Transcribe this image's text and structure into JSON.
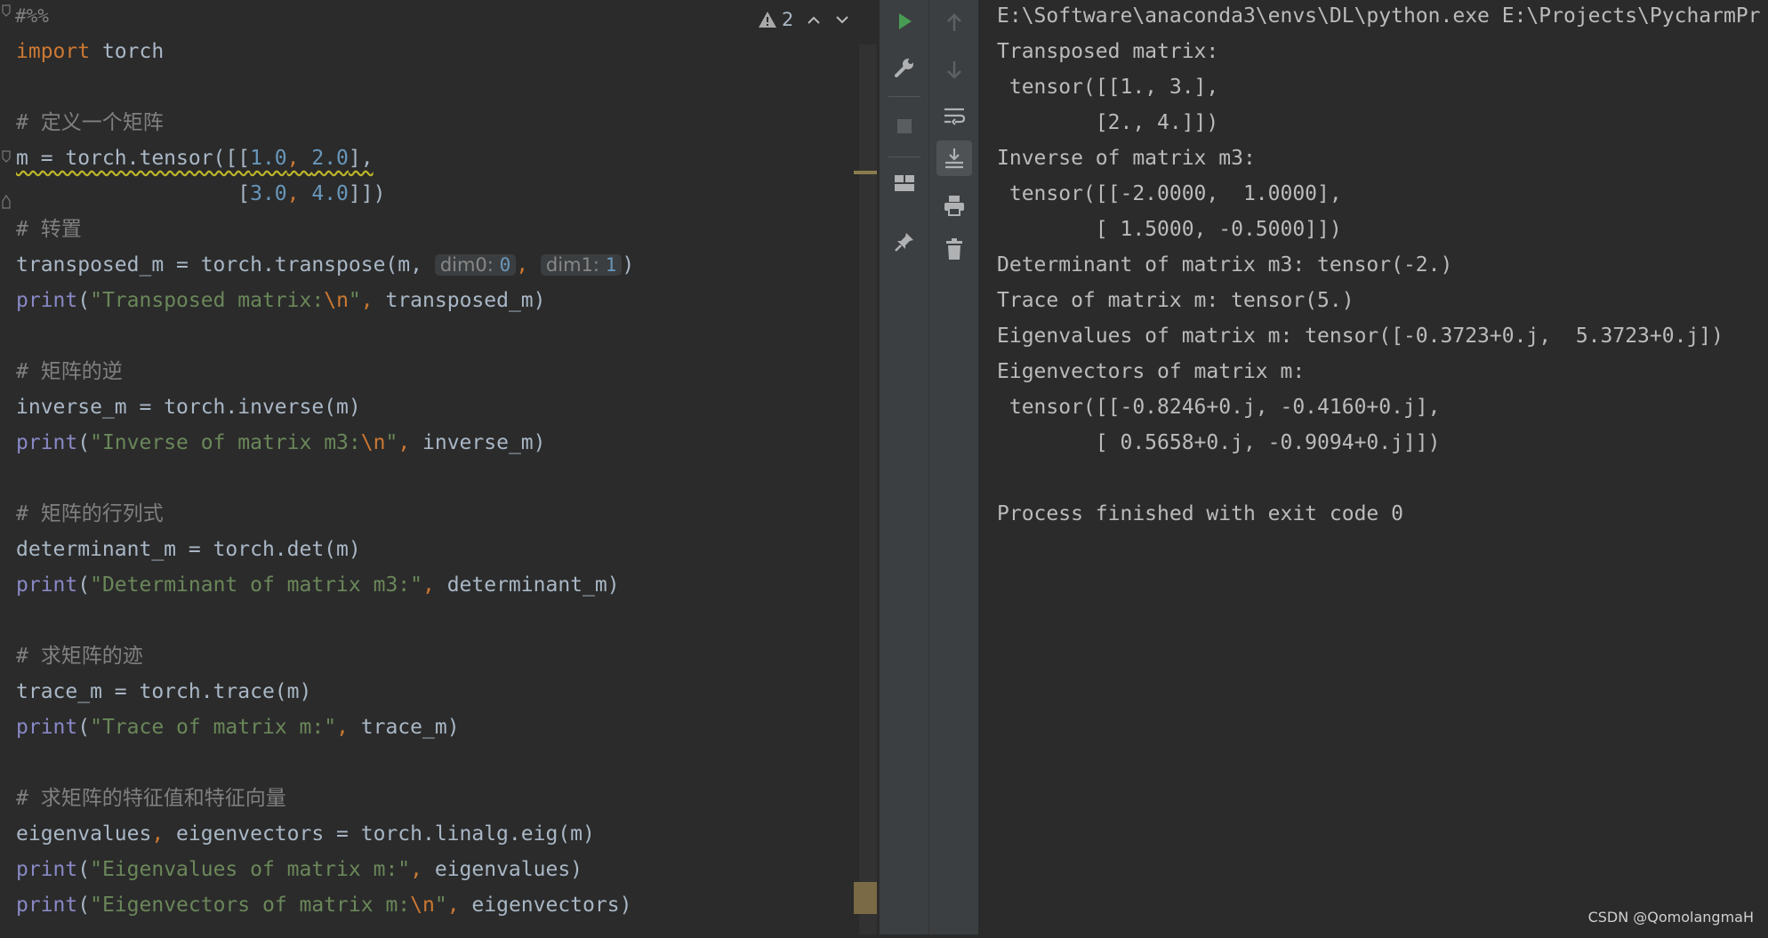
{
  "editor": {
    "cell_marker": "#%%",
    "l_import_kw": "import",
    "l_import_mod": " torch",
    "c_define": "# 定义一个矩阵",
    "l_m_pre": "m = torch.tensor([[",
    "n_1": "1.0",
    "n_2": "2.0",
    "l_m_post": "],",
    "l_m2_pre": "                  [",
    "n_3": "3.0",
    "n_4": "4.0",
    "l_m2_post": "]])",
    "comma_sep": ", ",
    "c_transpose": "# 转置",
    "l_tr_pre": "transposed_m = torch.transpose(m, ",
    "hint_dim0": "dim0:",
    "hint_dim0_val": "0",
    "hint_dim1": "dim1:",
    "hint_dim1_val": "1",
    "paren_close": ")",
    "print_kw": "print",
    "s_transposed": "\"Transposed matrix:",
    "esc_n": "\\n",
    "quote": "\"",
    "arg_transposed": " transposed_m)",
    "c_inverse": "# 矩阵的逆",
    "l_inv": "inverse_m = torch.inverse(m)",
    "s_inverse": "\"Inverse of matrix m3:",
    "arg_inverse": " inverse_m)",
    "c_det": "# 矩阵的行列式",
    "l_det": "determinant_m = torch.det(m)",
    "s_det": "\"Determinant of matrix m3:\"",
    "arg_det": " determinant_m)",
    "c_trace": "# 求矩阵的迹",
    "l_trace": "trace_m = torch.trace(m)",
    "s_trace": "\"Trace of matrix m:\"",
    "arg_trace": " trace_m)",
    "c_eig": "# 求矩阵的特征值和特征向量",
    "l_eig_a": "eigenvalues",
    "l_eig_b": " eigenvectors = torch.linalg.eig(m)",
    "s_eigval": "\"Eigenvalues of matrix m:\"",
    "arg_eigval": " eigenvalues)",
    "s_eigvec": "\"Eigenvectors of matrix m:",
    "arg_eigvec": " eigenvectors)",
    "open_paren": "(",
    "comma": ","
  },
  "inspection": {
    "warning_count": "2",
    "icon": "warning-icon",
    "warning_color": "#a9a9a9"
  },
  "console": {
    "lines": [
      "E:\\Software\\anaconda3\\envs\\DL\\python.exe E:\\Projects\\PycharmPr",
      "Transposed matrix:",
      " tensor([[1., 3.],",
      "        [2., 4.]])",
      "Inverse of matrix m3:",
      " tensor([[-2.0000,  1.0000],",
      "        [ 1.5000, -0.5000]])",
      "Determinant of matrix m3: tensor(-2.)",
      "Trace of matrix m: tensor(5.)",
      "Eigenvalues of matrix m: tensor([-0.3723+0.j,  5.3723+0.j])",
      "Eigenvectors of matrix m:",
      " tensor([[-0.8246+0.j, -0.4160+0.j],",
      "        [ 0.5658+0.j, -0.9094+0.j]])",
      "",
      "Process finished with exit code 0"
    ]
  },
  "toolbar": {
    "icons": [
      "run-icon",
      "settings-wrench-icon",
      "stop-icon",
      "layout-icon",
      "pin-icon",
      "up-arrow-icon",
      "down-arrow-icon",
      "soft-wrap-icon",
      "scroll-to-end-icon",
      "print-icon",
      "trash-icon"
    ],
    "run_color": "#499c54"
  },
  "watermark": "CSDN @QomolangmaH",
  "colors": {
    "keyword": "#cc7832",
    "string": "#6a8759",
    "number": "#6897bb",
    "comment": "#808080",
    "builtin": "#8888c6",
    "text": "#a9b7c6",
    "background": "#2b2b2b"
  }
}
